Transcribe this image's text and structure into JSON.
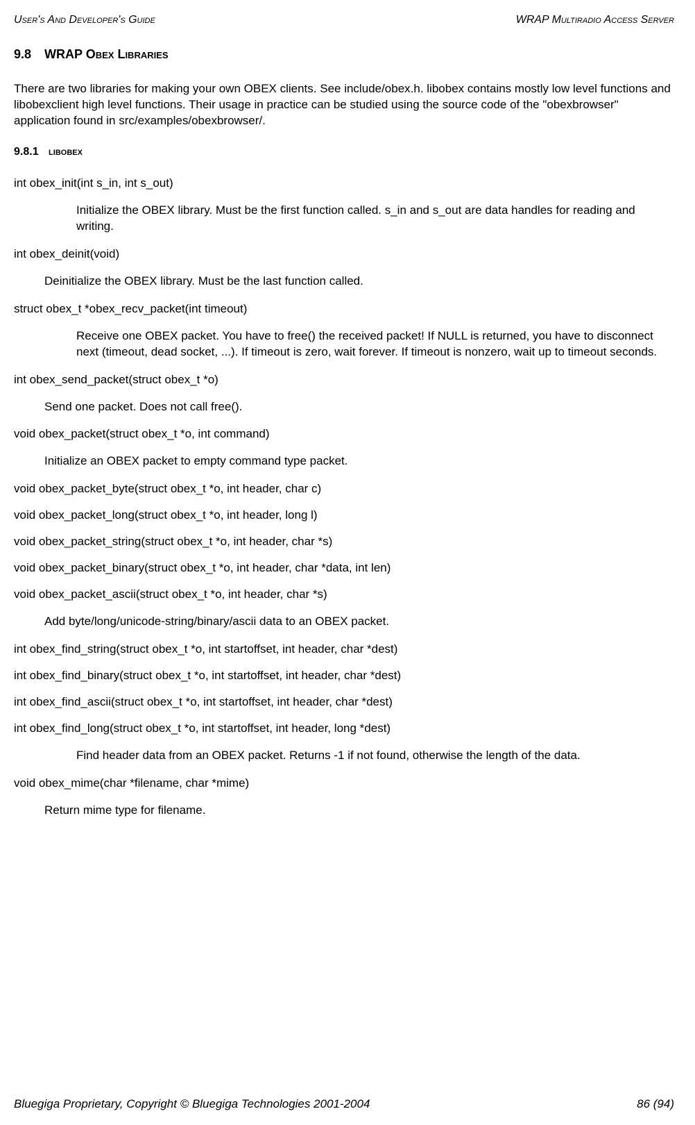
{
  "header": {
    "left": "User's And Developer's Guide",
    "right": "WRAP Multiradio Access Server"
  },
  "section": {
    "number": "9.8",
    "title": "WRAP Obex Libraries"
  },
  "intro": "There are two libraries for making your own OBEX clients. See include/obex.h. libobex contains mostly low level functions and libobexclient high level functions. Their usage in practice can be studied using the source code of the \"obexbrowser\" application found in src/examples/obexbrowser/.",
  "subsection": {
    "number": "9.8.1",
    "title": "libobex"
  },
  "items": [
    {
      "sig": "int obex_init(int s_in, int s_out)",
      "desc": "Initialize the OBEX library. Must be the first function called. s_in and s_out are data handles for reading and writing.",
      "indent": "long"
    },
    {
      "sig": "int obex_deinit(void)",
      "desc": "Deinitialize the OBEX library. Must be the last function called.",
      "indent": "short"
    },
    {
      "sig": "struct obex_t *obex_recv_packet(int timeout)",
      "desc": "Receive one OBEX packet. You have to free() the received packet! If NULL is returned, you have to disconnect next (timeout, dead socket, ...). If timeout is zero, wait forever. If timeout is nonzero, wait up to timeout seconds.",
      "indent": "long"
    },
    {
      "sig": "int obex_send_packet(struct obex_t *o)",
      "desc": "Send one packet. Does not call free().",
      "indent": "short"
    },
    {
      "sig": "void obex_packet(struct obex_t *o, int command)",
      "desc": "Initialize an OBEX packet to empty command type packet.",
      "indent": "short"
    },
    {
      "sig": "void obex_packet_byte(struct obex_t *o, int header, char c)"
    },
    {
      "sig": "void obex_packet_long(struct obex_t *o, int header, long l)"
    },
    {
      "sig": "void obex_packet_string(struct obex_t *o, int header, char *s)"
    },
    {
      "sig": "void obex_packet_binary(struct obex_t *o, int header, char *data, int len)"
    },
    {
      "sig": "void obex_packet_ascii(struct obex_t *o, int header, char *s)",
      "desc": "Add byte/long/unicode-string/binary/ascii data to an OBEX packet.",
      "indent": "short"
    },
    {
      "sig": "int obex_find_string(struct obex_t *o, int startoffset, int header, char *dest)"
    },
    {
      "sig": "int obex_find_binary(struct obex_t *o, int startoffset, int header, char *dest)"
    },
    {
      "sig": "int obex_find_ascii(struct obex_t *o, int startoffset, int header, char *dest)"
    },
    {
      "sig": "int obex_find_long(struct obex_t *o, int startoffset, int header, long *dest)",
      "desc": "Find header data from an OBEX packet. Returns -1 if not found, otherwise the length of the data.",
      "indent": "long"
    },
    {
      "sig": "void obex_mime(char *filename, char *mime)",
      "desc": "Return mime type for filename.",
      "indent": "short"
    }
  ],
  "footer": {
    "left": "Bluegiga Proprietary, Copyright © Bluegiga Technologies 2001-2004",
    "right": "86 (94)"
  }
}
